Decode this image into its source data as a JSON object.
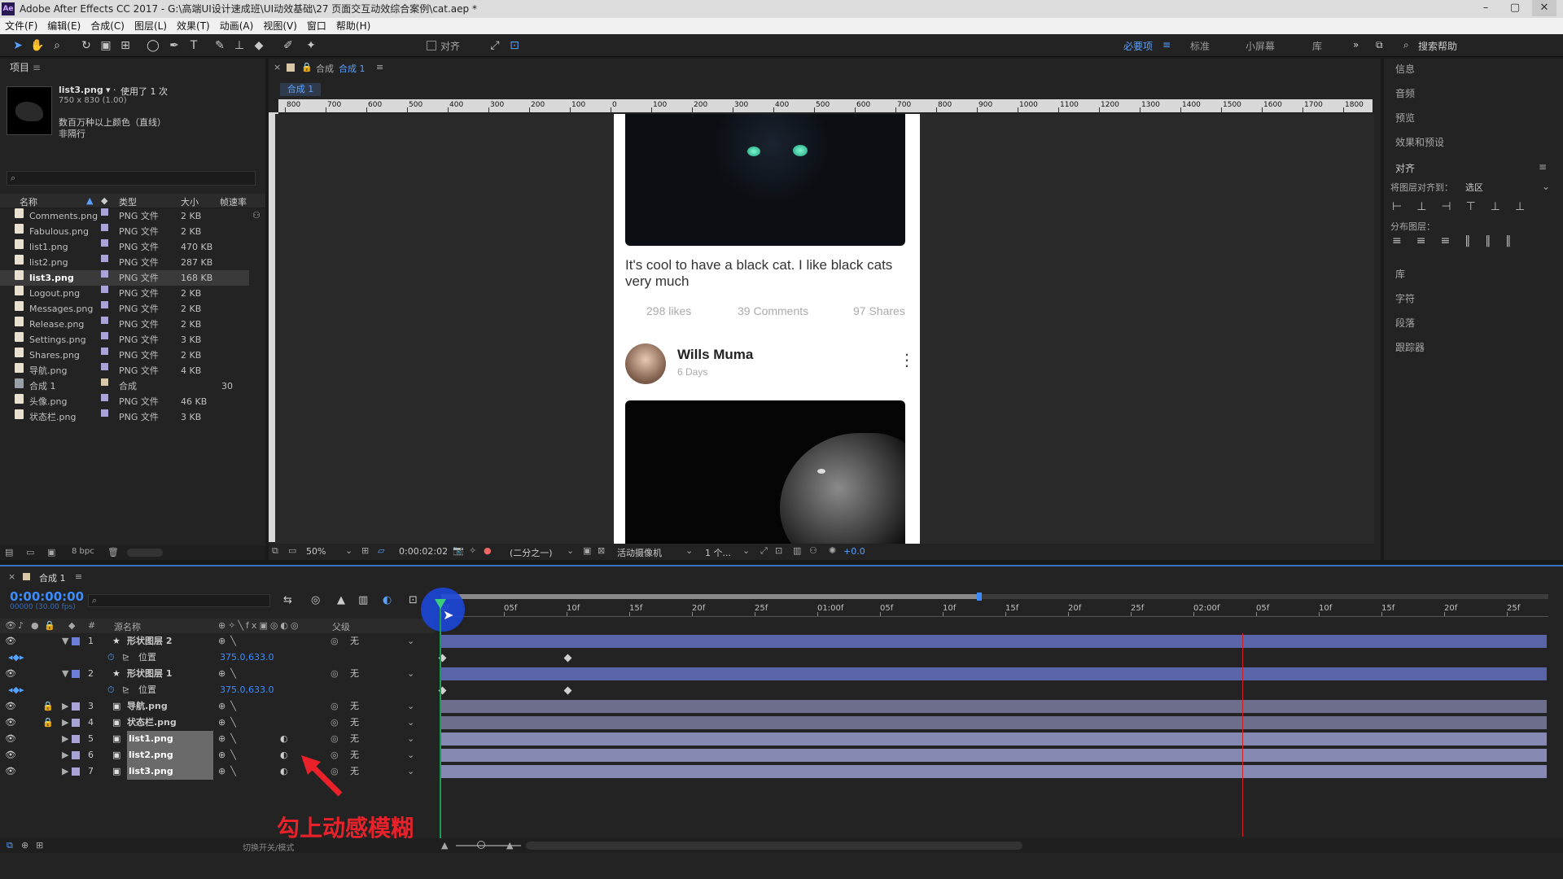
{
  "window": {
    "title": "Adobe After Effects CC 2017 - G:\\高端UI设计速成班\\UI动效基础\\27 页面交互动效综合案例\\cat.aep *",
    "app_badge": "Ae",
    "min": "–",
    "max": "▢",
    "close": "✕"
  },
  "menu": [
    "文件(F)",
    "编辑(E)",
    "合成(C)",
    "图层(L)",
    "效果(T)",
    "动画(A)",
    "视图(V)",
    "窗口",
    "帮助(H)"
  ],
  "toolbar": {
    "align_label": "对齐",
    "workspaces": [
      "必要项",
      "标准",
      "小屏幕",
      "库"
    ],
    "active_workspace": "必要项",
    "search_help": "搜索帮助",
    "more": "»"
  },
  "project": {
    "title": "项目",
    "selected_name": "list3.png",
    "used": "使用了 1 次",
    "dims": "750 x 830 (1.00)",
    "color_note": "数百万种以上颜色（直线）",
    "interlace": "非隔行",
    "search_placeholder": "",
    "columns": {
      "name": "名称",
      "type": "类型",
      "size": "大小",
      "fps": "帧速率"
    },
    "items": [
      {
        "name": "Comments.png",
        "type": "PNG 文件",
        "size": "2 KB",
        "fps": ""
      },
      {
        "name": "Fabulous.png",
        "type": "PNG 文件",
        "size": "2 KB",
        "fps": ""
      },
      {
        "name": "list1.png",
        "type": "PNG 文件",
        "size": "470 KB",
        "fps": ""
      },
      {
        "name": "list2.png",
        "type": "PNG 文件",
        "size": "287 KB",
        "fps": ""
      },
      {
        "name": "list3.png",
        "type": "PNG 文件",
        "size": "168 KB",
        "fps": ""
      },
      {
        "name": "Logout.png",
        "type": "PNG 文件",
        "size": "2 KB",
        "fps": ""
      },
      {
        "name": "Messages.png",
        "type": "PNG 文件",
        "size": "2 KB",
        "fps": ""
      },
      {
        "name": "Release.png",
        "type": "PNG 文件",
        "size": "2 KB",
        "fps": ""
      },
      {
        "name": "Settings.png",
        "type": "PNG 文件",
        "size": "3 KB",
        "fps": ""
      },
      {
        "name": "Shares.png",
        "type": "PNG 文件",
        "size": "2 KB",
        "fps": ""
      },
      {
        "name": "导航.png",
        "type": "PNG 文件",
        "size": "4 KB",
        "fps": ""
      },
      {
        "name": "合成 1",
        "type": "合成",
        "size": "",
        "fps": "30"
      },
      {
        "name": "头像.png",
        "type": "PNG 文件",
        "size": "46 KB",
        "fps": ""
      },
      {
        "name": "状态栏.png",
        "type": "PNG 文件",
        "size": "3 KB",
        "fps": ""
      }
    ],
    "bpc": "8 bpc"
  },
  "comp": {
    "tab_prefix": "合成",
    "tab_name": "合成 1",
    "sub_tab": "合成 1",
    "ruler": [
      "800",
      "700",
      "600",
      "500",
      "400",
      "300",
      "200",
      "100",
      "0",
      "100",
      "200",
      "300",
      "400",
      "500",
      "600",
      "700",
      "800",
      "900",
      "1000",
      "1100",
      "1200",
      "1300",
      "1400",
      "1500",
      "1600",
      "1700",
      "1800"
    ],
    "zoom": "50%",
    "timecode": "0:00:02:02",
    "resolution": "(二分之一)",
    "camera": "活动摄像机",
    "views": "1 个...",
    "exposure": "+0.0"
  },
  "card": {
    "caption": "It's cool to have a black cat. I like black cats very much",
    "likes": "298 likes",
    "comments": "39 Comments",
    "shares": "97 Shares",
    "author": "Wills Muma",
    "days": "6 Days",
    "more": "⋮"
  },
  "right_panel": {
    "items": [
      "信息",
      "音频",
      "预览",
      "效果和预设"
    ],
    "align_title": "对齐",
    "align_to_label": "将图层对齐到：",
    "align_to_value": "选区",
    "distribute_label": "分布图层：",
    "lower_items": [
      "库",
      "字符",
      "段落",
      "跟踪器"
    ]
  },
  "timeline": {
    "tab": "合成 1",
    "timecode": "0:00:00:00",
    "fps_note": "00000 (30.00 fps)",
    "search_placeholder": "",
    "col_num": "#",
    "col_name": "源名称",
    "col_parent": "父级",
    "ruler": [
      "0f",
      "05f",
      "10f",
      "15f",
      "20f",
      "25f",
      "01:00f",
      "05f",
      "10f",
      "15f",
      "20f",
      "25f",
      "02:00f",
      "05f",
      "10f",
      "15f",
      "20f",
      "25f"
    ],
    "layers": [
      {
        "num": "1",
        "name": "形状图层 2",
        "parent": "无",
        "type": "shape"
      },
      {
        "num": "",
        "name": "位置",
        "value": "375.0,633.0",
        "type": "prop"
      },
      {
        "num": "2",
        "name": "形状图层 1",
        "parent": "无",
        "type": "shape"
      },
      {
        "num": "",
        "name": "位置",
        "value": "375.0,633.0",
        "type": "prop"
      },
      {
        "num": "3",
        "name": "导航.png",
        "parent": "无",
        "type": "file"
      },
      {
        "num": "4",
        "name": "状态栏.png",
        "parent": "无",
        "type": "file"
      },
      {
        "num": "5",
        "name": "list1.png",
        "parent": "无",
        "type": "file"
      },
      {
        "num": "6",
        "name": "list2.png",
        "parent": "无",
        "type": "file"
      },
      {
        "num": "7",
        "name": "list3.png",
        "parent": "无",
        "type": "file"
      }
    ],
    "footer": "切换开关/模式",
    "annotation": "勾上动感模糊"
  },
  "colors": {
    "accent": "#3a72c8",
    "annotation": "#e8212a",
    "label_blue": "#6b7fd8",
    "label_lavender": "#a8a4d8",
    "bar": "#6c6e8c"
  }
}
